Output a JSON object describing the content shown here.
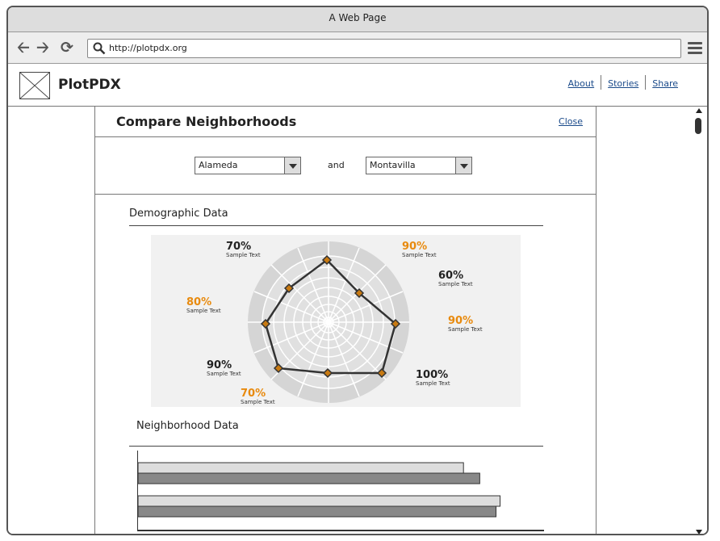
{
  "browser": {
    "title": "A Web Page",
    "url": "http://plotpdx.org"
  },
  "site": {
    "brand": "PlotPDX",
    "links": [
      "About",
      "Stories",
      "Share"
    ]
  },
  "panel": {
    "title": "Compare Neighborhoods",
    "close_label": "Close",
    "select_a": "Alameda",
    "select_b": "Montavilla",
    "and_label": "and",
    "demographic_title": "Demographic Data",
    "neighborhood_title": "Neighborhood Data"
  },
  "radar_labels": [
    {
      "value": "70%",
      "caption": "Sample Text",
      "color": "#222222"
    },
    {
      "value": "90%",
      "caption": "Sample Text",
      "color": "#e88a0e"
    },
    {
      "value": "60%",
      "caption": "Sample Text",
      "color": "#222222"
    },
    {
      "value": "90%",
      "caption": "Sample Text",
      "color": "#e88a0e"
    },
    {
      "value": "100%",
      "caption": "Sample Text",
      "color": "#222222"
    },
    {
      "value": "70%",
      "caption": "Sample Text",
      "color": "#e88a0e"
    },
    {
      "value": "90%",
      "caption": "Sample Text",
      "color": "#222222"
    },
    {
      "value": "80%",
      "caption": "Sample Text",
      "color": "#e88a0e"
    }
  ],
  "chart_data": {
    "type": "bar",
    "orientation": "horizontal",
    "series": [
      {
        "values": [
          80,
          89
        ]
      },
      {
        "values": [
          84,
          88
        ]
      }
    ],
    "colors": [
      "#dddddd",
      "#888888"
    ]
  }
}
